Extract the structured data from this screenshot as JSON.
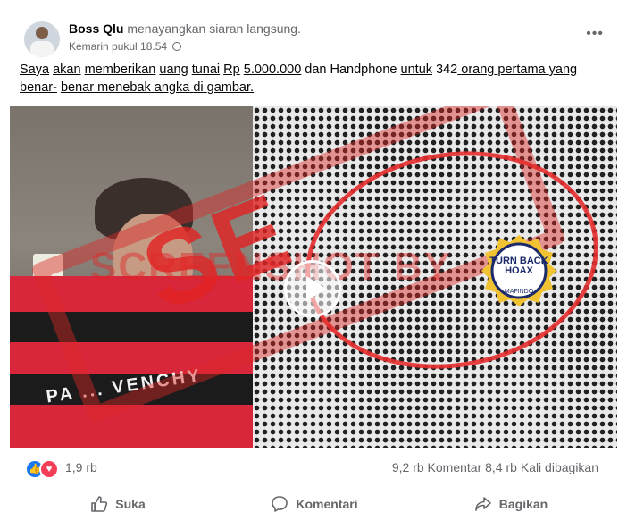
{
  "post": {
    "author": "Boss Qlu",
    "action": "menayangkan siaran langsung.",
    "timestamp": "Kemarin pukul 18.54",
    "privacy_icon": "globe-icon",
    "caption_parts": [
      "Saya",
      " ",
      "akan",
      " ",
      "memberikan",
      " ",
      "uang",
      " ",
      "tunai",
      " ",
      "Rp",
      " ",
      "5.000.000",
      " dan Handphone ",
      "untuk",
      " ",
      "342",
      " ",
      "orang",
      " ",
      "pertama",
      " ",
      "yang",
      " ",
      "benar-",
      " ",
      "benar",
      " ",
      "menebak",
      " ",
      "angka",
      " ",
      "di",
      " ",
      "gambar."
    ]
  },
  "media": {
    "watermark": "SCREENSHOT BY",
    "stamp": "SE",
    "shirt_text": "PA ... VENCHY",
    "badge_title": "TURN BACK HOAX",
    "badge_org": "MAFINDO",
    "play_icon": "play-icon"
  },
  "stats": {
    "reactions_count": "1,9 rb",
    "comments_shares": "9,2 rb Komentar  8,4 rb Kali dibagikan"
  },
  "actions": {
    "like": "Suka",
    "comment": "Komentari",
    "share": "Bagikan"
  },
  "colors": {
    "facebook_blue": "#1877f2",
    "love_red": "#f33e58",
    "stamp_red": "#e02b2b"
  }
}
